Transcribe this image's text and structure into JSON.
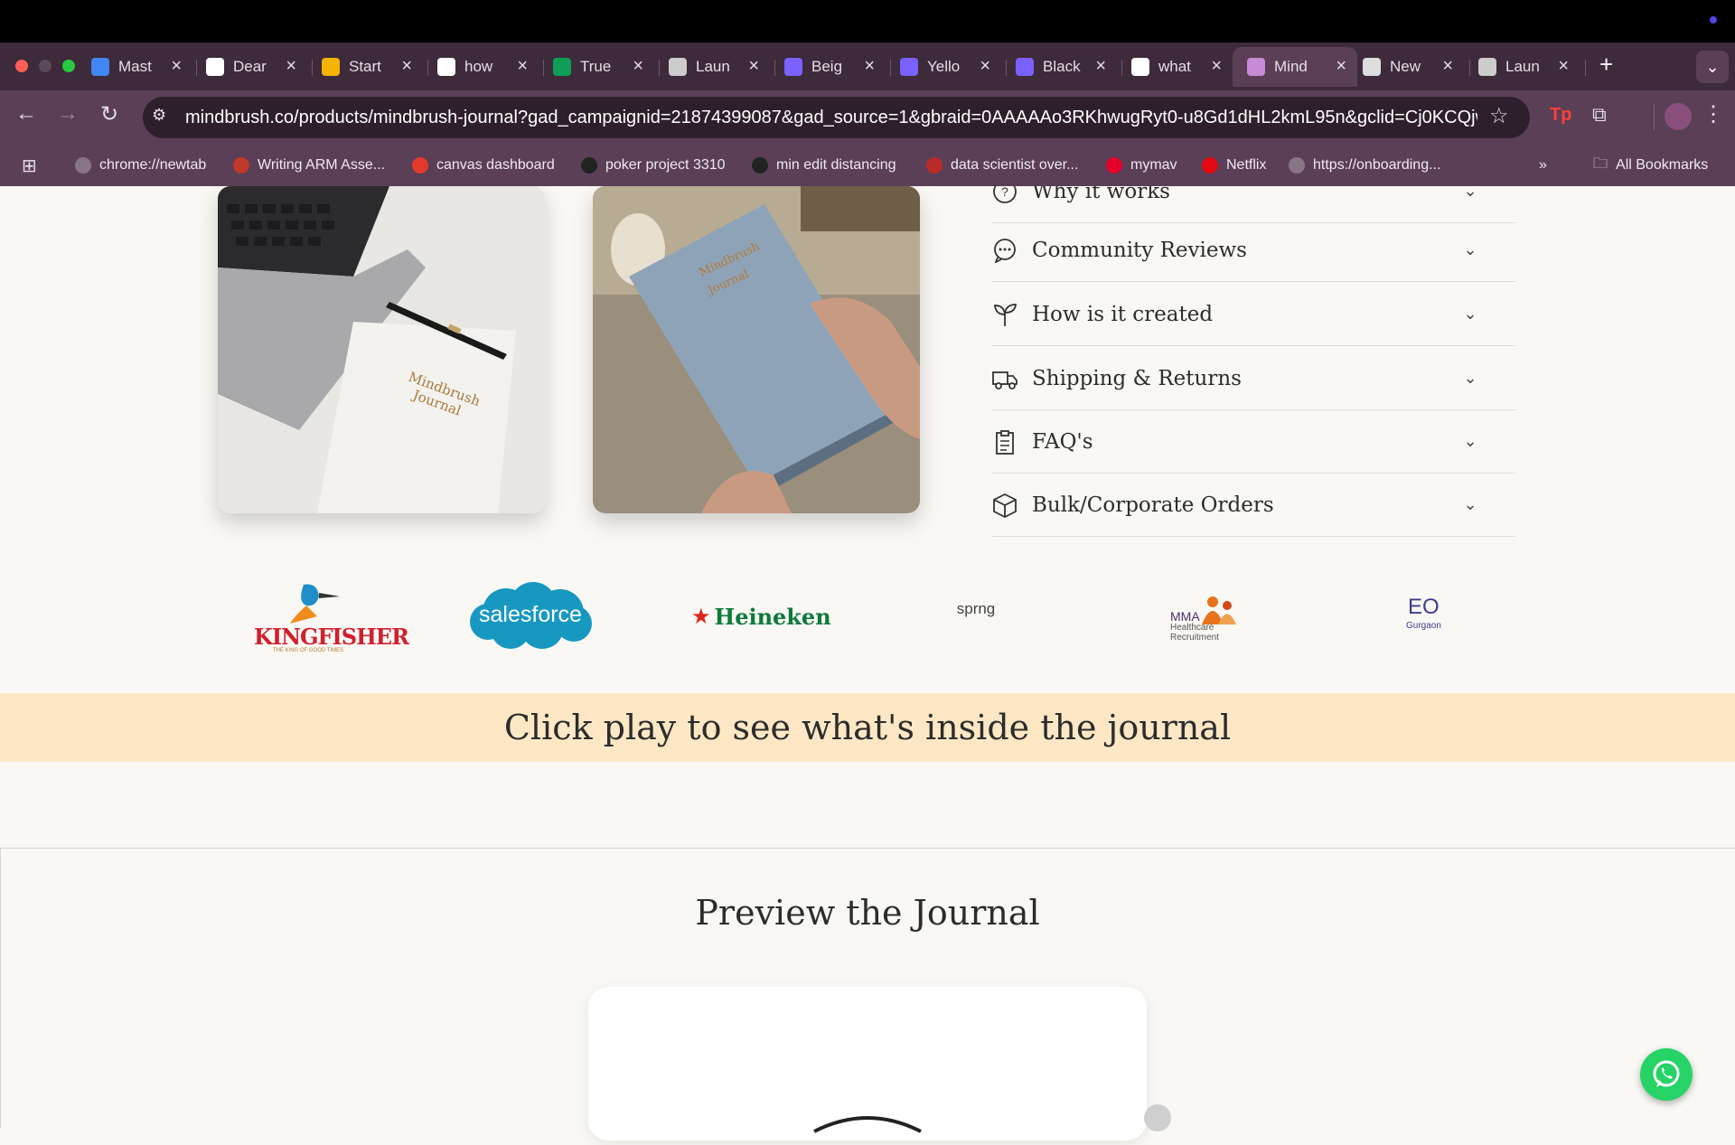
{
  "browser": {
    "tabs": [
      {
        "title": "Mast",
        "favicon": "docs-icon",
        "color": "#4285f4"
      },
      {
        "title": "Dear",
        "favicon": "chatgpt-icon",
        "color": "#ffffff"
      },
      {
        "title": "Start",
        "favicon": "slides-icon",
        "color": "#f4b400"
      },
      {
        "title": "how",
        "favicon": "google-icon",
        "color": "#ffffff"
      },
      {
        "title": "True",
        "favicon": "drive-icon",
        "color": "#0f9d58"
      },
      {
        "title": "Laun",
        "favicon": "globe-icon",
        "color": "#cccccc"
      },
      {
        "title": "Beig",
        "favicon": "canva-icon",
        "color": "#7b61ff"
      },
      {
        "title": "Yello",
        "favicon": "canva-icon",
        "color": "#7b61ff"
      },
      {
        "title": "Black",
        "favicon": "canva-icon",
        "color": "#7b61ff"
      },
      {
        "title": "what",
        "favicon": "google-icon",
        "color": "#ffffff"
      },
      {
        "title": "Mind",
        "favicon": "mindbrush-icon",
        "color": "#c78ad6",
        "active": true
      },
      {
        "title": "New",
        "favicon": "chrome-icon",
        "color": "#dddddd"
      },
      {
        "title": "Laun",
        "favicon": "globe-icon",
        "color": "#cccccc"
      }
    ],
    "url": "mindbrush.co/products/mindbrush-journal?gad_campaignid=21874399087&gad_source=1&gbraid=0AAAAAo3RKhwugRyt0-u8Gd1dHL2kmL95n&gclid=Cj0KCQjw_...",
    "bookmarks": [
      {
        "label": "chrome://newtab",
        "icon": "globe-icon"
      },
      {
        "label": "Writing ARM Asse...",
        "icon": "arm-icon"
      },
      {
        "label": "canvas dashboard",
        "icon": "canvas-icon"
      },
      {
        "label": "poker project 3310",
        "icon": "github-icon"
      },
      {
        "label": "min edit distancing",
        "icon": "github-icon"
      },
      {
        "label": "data scientist over...",
        "icon": "quora-icon"
      },
      {
        "label": "mymav",
        "icon": "uta-icon"
      },
      {
        "label": "Netflix",
        "icon": "netflix-icon"
      },
      {
        "label": "https://onboarding...",
        "icon": "globe-icon"
      }
    ],
    "all_bookmarks": "All Bookmarks"
  },
  "page": {
    "images": [
      {
        "alt": "Mindbrush Journal",
        "subject": "laptop-and-journal"
      },
      {
        "alt": "Mindbrush Journal",
        "subject": "hands-holding-journal"
      }
    ],
    "accordion": [
      {
        "label": "Why it works",
        "icon": "question-icon"
      },
      {
        "label": "Community Reviews",
        "icon": "chat-icon"
      },
      {
        "label": "How is it created",
        "icon": "sprout-icon"
      },
      {
        "label": "Shipping & Returns",
        "icon": "truck-icon"
      },
      {
        "label": "FAQ's",
        "icon": "clipboard-icon"
      },
      {
        "label": "Bulk/Corporate Orders",
        "icon": "box-icon"
      }
    ],
    "logos": [
      {
        "name": "KINGFISHER",
        "tagline": "THE KING OF GOOD TIMES"
      },
      {
        "name": "salesforce"
      },
      {
        "name": "Heineken"
      },
      {
        "name": "sprng"
      },
      {
        "name": "MMA",
        "line2": "Healthcare",
        "line3": "Recruitment"
      },
      {
        "name": "EO",
        "line2": "Gurgaon"
      }
    ],
    "banner_text": "Click play to see what's inside the journal",
    "preview_title": "Preview the Journal"
  }
}
